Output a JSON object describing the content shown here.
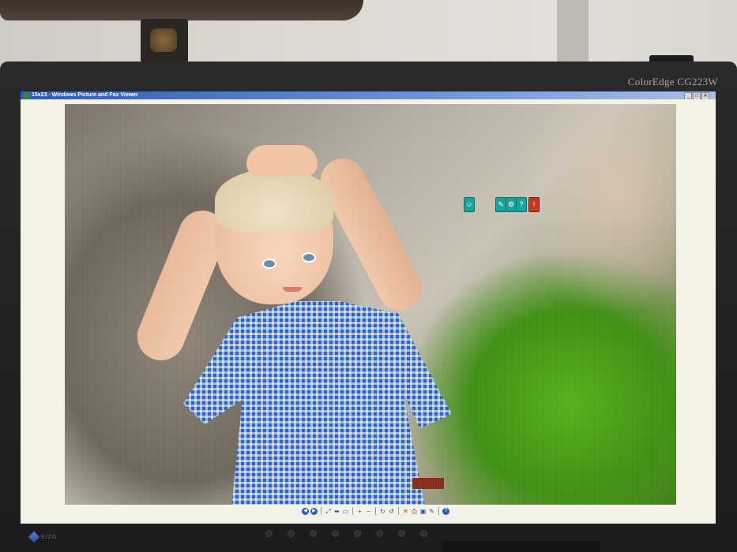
{
  "monitor": {
    "brand": "ColorEdge CG223W",
    "maker": "EIZO"
  },
  "window": {
    "title": "15x23 - Windows Picture and Fax Viewer",
    "controls": [
      "_",
      "□",
      "✕"
    ]
  },
  "photo": {
    "subject": "child in blue gingham shirt with hands on head",
    "icons": [
      "person-icon",
      "wrench-icon",
      "gear-icon",
      "help-icon",
      "alert-icon"
    ]
  },
  "overlay_buttons": {
    "first": "☺",
    "group": [
      "✎",
      "⚙",
      "?"
    ],
    "alert": "!"
  },
  "toolbar": {
    "buttons": [
      {
        "name": "previous-image-button",
        "glyph": "◀",
        "round": true
      },
      {
        "name": "next-image-button",
        "glyph": "▶",
        "round": true
      },
      {
        "name": "best-fit-button",
        "glyph": "⤢"
      },
      {
        "name": "actual-size-button",
        "glyph": "⬌"
      },
      {
        "name": "slideshow-button",
        "glyph": "▭"
      },
      {
        "name": "zoom-in-button",
        "glyph": "+"
      },
      {
        "name": "zoom-out-button",
        "glyph": "−"
      },
      {
        "name": "rotate-clockwise-button",
        "glyph": "↻"
      },
      {
        "name": "rotate-counterclockwise-button",
        "glyph": "↺"
      },
      {
        "name": "delete-button",
        "glyph": "✕"
      },
      {
        "name": "print-button",
        "glyph": "⎙"
      },
      {
        "name": "copy-to-button",
        "glyph": "▣"
      },
      {
        "name": "open-for-editing-button",
        "glyph": "✎"
      },
      {
        "name": "help-button",
        "glyph": "?",
        "round": true
      }
    ]
  }
}
